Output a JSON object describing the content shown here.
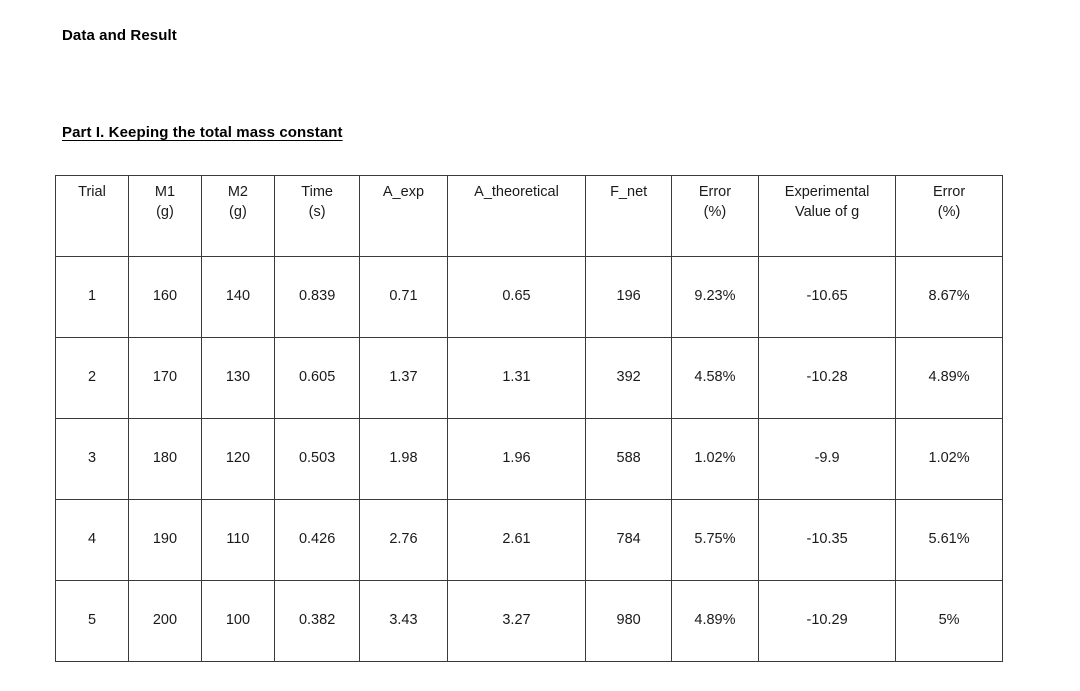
{
  "document": {
    "title": "Data and Result",
    "section_heading": "Part I. Keeping the total mass constant"
  },
  "table": {
    "headers": [
      {
        "line1": "Trial",
        "line2": ""
      },
      {
        "line1": "M1",
        "line2": "(g)"
      },
      {
        "line1": "M2",
        "line2": "(g)"
      },
      {
        "line1": "Time",
        "line2": "(s)"
      },
      {
        "line1": "A_exp",
        "line2": ""
      },
      {
        "line1": "A_theoretical",
        "line2": ""
      },
      {
        "line1": "F_net",
        "line2": ""
      },
      {
        "line1": "Error",
        "line2": "(%)"
      },
      {
        "line1": "Experimental",
        "line2": "Value of g"
      },
      {
        "line1": "Error",
        "line2": "(%)"
      }
    ],
    "rows": [
      {
        "trial": "1",
        "m1": "160",
        "m2": "140",
        "time": "0.839",
        "a_exp": "0.71",
        "a_theoretical": "0.65",
        "f_net": "196",
        "error_a": "9.23%",
        "exp_g": "-10.65",
        "error_g": "8.67%"
      },
      {
        "trial": "2",
        "m1": "170",
        "m2": "130",
        "time": "0.605",
        "a_exp": "1.37",
        "a_theoretical": "1.31",
        "f_net": "392",
        "error_a": "4.58%",
        "exp_g": "-10.28",
        "error_g": "4.89%"
      },
      {
        "trial": "3",
        "m1": "180",
        "m2": "120",
        "time": "0.503",
        "a_exp": "1.98",
        "a_theoretical": "1.96",
        "f_net": "588",
        "error_a": "1.02%",
        "exp_g": "-9.9",
        "error_g": "1.02%"
      },
      {
        "trial": "4",
        "m1": "190",
        "m2": "110",
        "time": "0.426",
        "a_exp": "2.76",
        "a_theoretical": "2.61",
        "f_net": "784",
        "error_a": "5.75%",
        "exp_g": "-10.35",
        "error_g": "5.61%"
      },
      {
        "trial": "5",
        "m1": "200",
        "m2": "100",
        "time": "0.382",
        "a_exp": "3.43",
        "a_theoretical": "3.27",
        "f_net": "980",
        "error_a": "4.89%",
        "exp_g": "-10.29",
        "error_g": "5%"
      }
    ]
  },
  "chart_data": {
    "type": "table",
    "title": "Part I. Keeping the total mass constant",
    "columns": [
      "Trial",
      "M1 (g)",
      "M2 (g)",
      "Time (s)",
      "A_exp",
      "A_theoretical",
      "F_net",
      "Error (%)",
      "Experimental Value of g",
      "Error (%)"
    ],
    "rows": [
      [
        "1",
        "160",
        "140",
        "0.839",
        "0.71",
        "0.65",
        "196",
        "9.23%",
        "-10.65",
        "8.67%"
      ],
      [
        "2",
        "170",
        "130",
        "0.605",
        "1.37",
        "1.31",
        "392",
        "4.58%",
        "-10.28",
        "4.89%"
      ],
      [
        "3",
        "180",
        "120",
        "0.503",
        "1.98",
        "1.96",
        "588",
        "1.02%",
        "-9.9",
        "1.02%"
      ],
      [
        "4",
        "190",
        "110",
        "0.426",
        "2.76",
        "2.61",
        "784",
        "5.75%",
        "-10.35",
        "5.61%"
      ],
      [
        "5",
        "200",
        "100",
        "0.382",
        "3.43",
        "3.27",
        "980",
        "4.89%",
        "-10.29",
        "5%"
      ]
    ]
  }
}
